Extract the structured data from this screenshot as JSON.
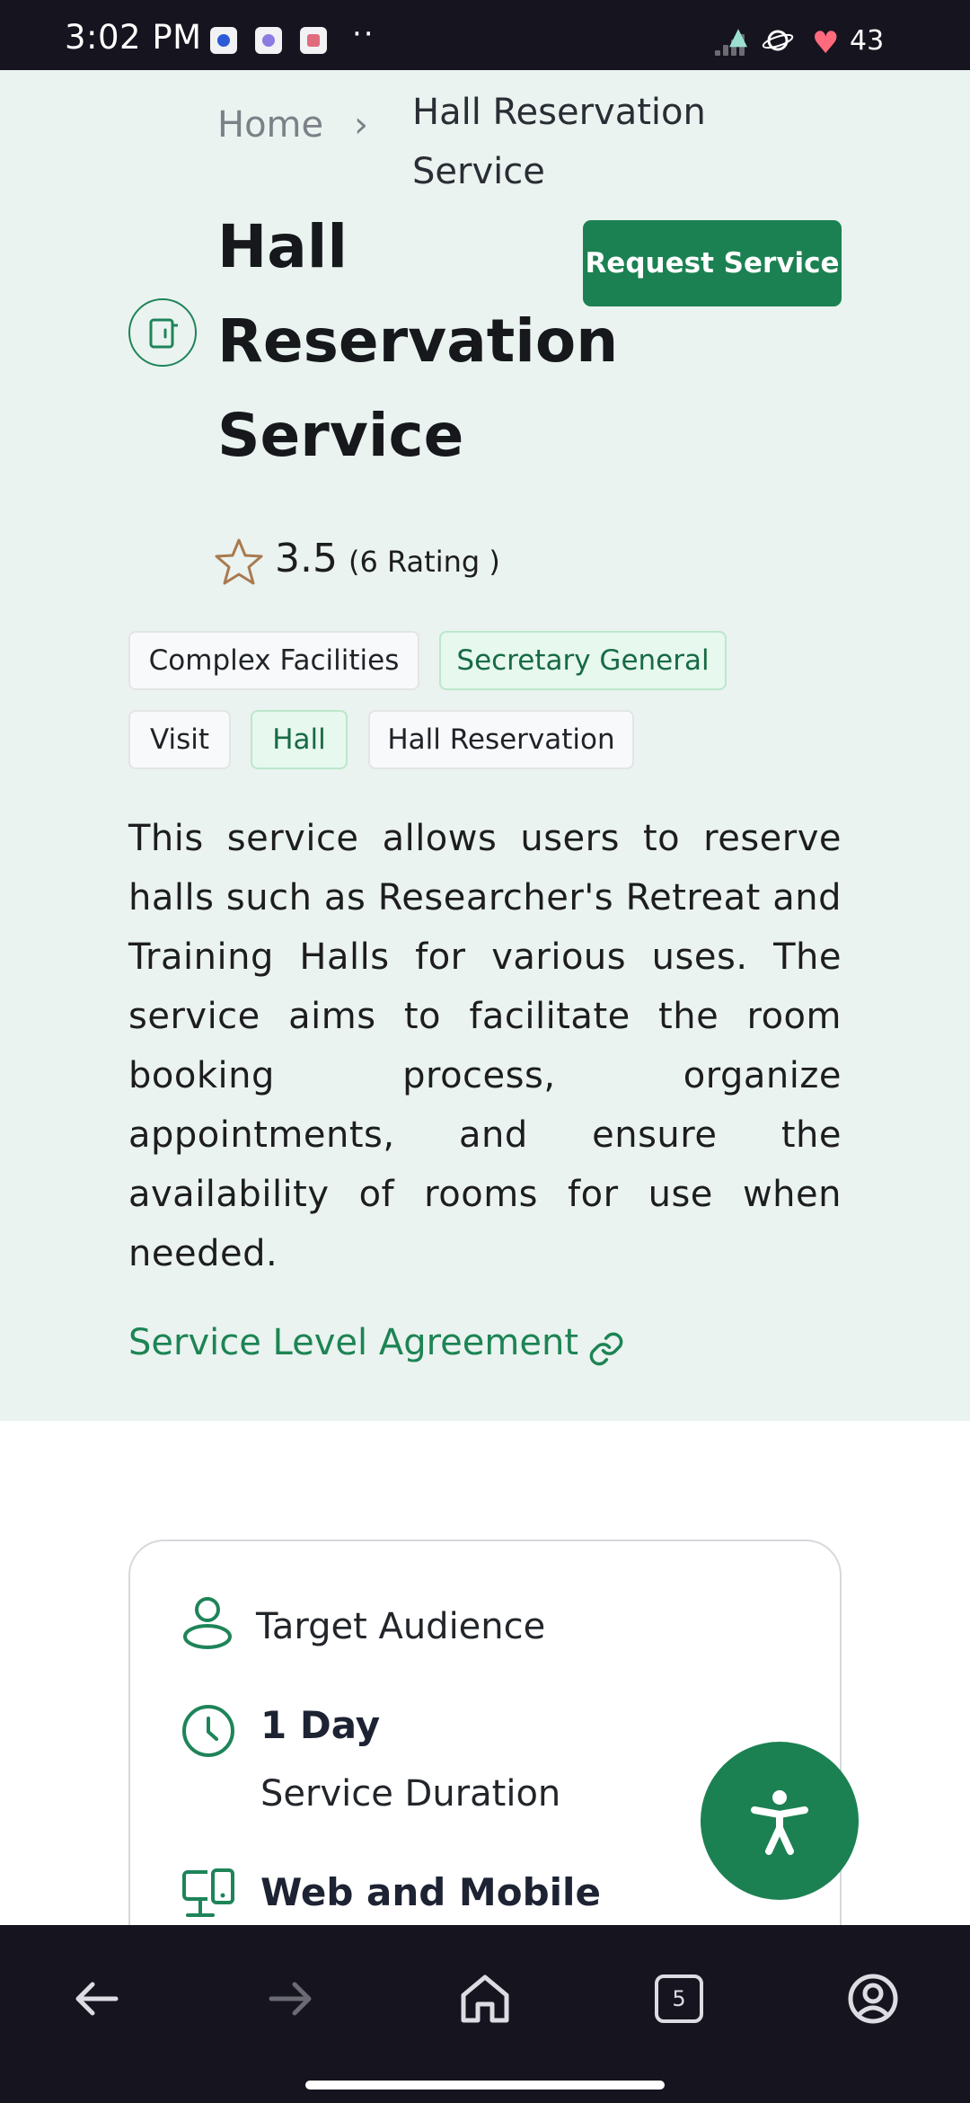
{
  "status_bar": {
    "time": "3:02 PM",
    "more": "··",
    "battery": "43"
  },
  "breadcrumb": {
    "home": "Home",
    "separator": "›",
    "current": "Hall Reservation Service"
  },
  "service": {
    "title": "Hall Reservation Service",
    "request_button": "Request Service",
    "rating_value": "3.5",
    "rating_count": "(6 Rating )",
    "tags": [
      "Complex Facilities",
      "Secretary General",
      "Visit",
      "Hall",
      "Hall Reservation"
    ],
    "description": "This service allows users to reserve halls such as Researcher's Retreat and Training Halls for various uses. The service aims to facilitate the room booking process, organize appointments, and ensure the availability of rooms for use when needed.",
    "sla_link": "Service Level Agreement"
  },
  "info_card": {
    "target_audience": "Target Audience",
    "duration_value": "1 Day",
    "duration_label": "Service Duration",
    "channel_value": "Web and Mobile"
  },
  "bottom_nav": {
    "tab_count": "5"
  },
  "colors": {
    "accent": "#1c8152",
    "hero_bg": "#eaf3f0",
    "system_bar": "#15141f"
  },
  "icons": [
    "door-icon",
    "star-icon",
    "link-icon",
    "person-icon",
    "clock-icon",
    "devices-icon",
    "accessibility-icon",
    "back-arrow-icon",
    "forward-arrow-icon",
    "home-icon",
    "account-icon"
  ]
}
